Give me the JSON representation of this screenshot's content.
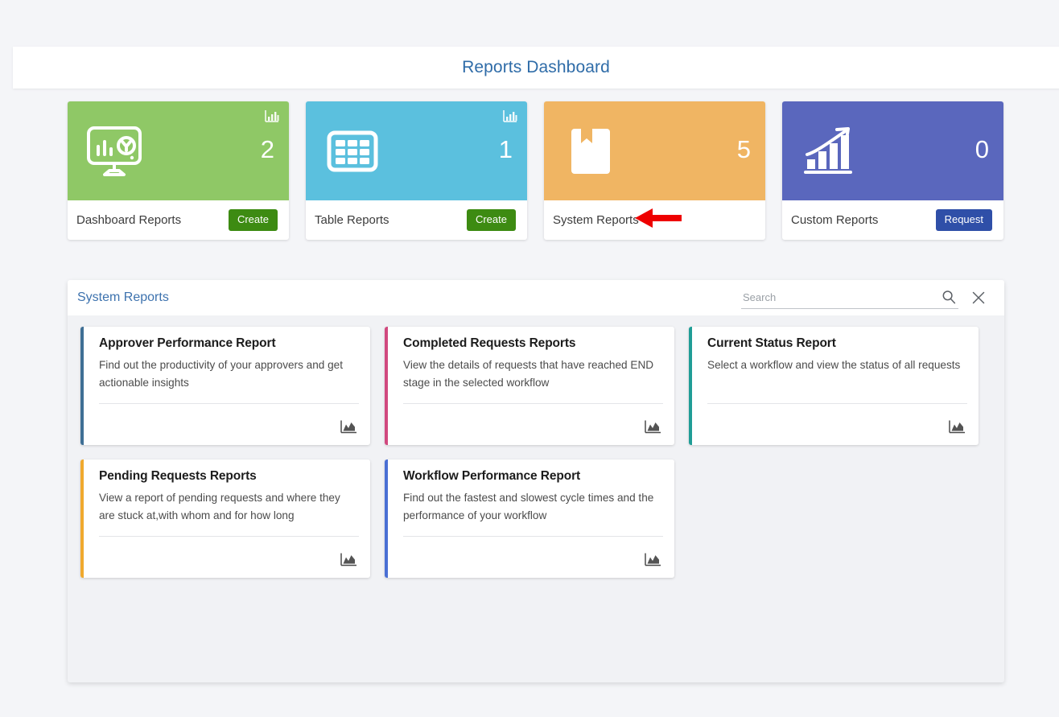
{
  "header": {
    "title": "Reports Dashboard"
  },
  "tiles": [
    {
      "label": "Dashboard Reports",
      "count": "2",
      "color": "#8fc866",
      "icon": "monitor-chart-icon",
      "badge_icon": "bar-chart-badge-icon",
      "has_badge": true,
      "button": {
        "label": "Create",
        "style": "create"
      },
      "annotated": false
    },
    {
      "label": "Table Reports",
      "count": "1",
      "color": "#5bc0de",
      "icon": "table-grid-icon",
      "badge_icon": "bar-chart-badge-icon",
      "has_badge": true,
      "button": {
        "label": "Create",
        "style": "create"
      },
      "annotated": false
    },
    {
      "label": "System Reports",
      "count": "5",
      "color": "#f0b563",
      "icon": "bookmark-book-icon",
      "badge_icon": "",
      "has_badge": false,
      "button": null,
      "annotated": true
    },
    {
      "label": "Custom Reports",
      "count": "0",
      "color": "#5a67bd",
      "icon": "growth-bar-chart-icon",
      "badge_icon": "",
      "has_badge": false,
      "button": {
        "label": "Request",
        "style": "request"
      },
      "annotated": false
    }
  ],
  "panel": {
    "title": "System Reports",
    "search": {
      "value": "",
      "placeholder": "Search",
      "icon": "search-icon",
      "close_icon": "close-icon"
    },
    "cards": [
      {
        "title": "Approver Performance Report",
        "description": "Find out the productivity of your approvers and get actionable insights",
        "accent": "#3f6f95",
        "chart_icon": "area-chart-icon"
      },
      {
        "title": "Completed Requests Reports",
        "description": "View the details of requests that have reached END stage in the selected workflow",
        "accent": "#d1497f",
        "chart_icon": "area-chart-icon"
      },
      {
        "title": "Current Status Report",
        "description": "Select a workflow and view the status of all requests",
        "accent": "#1f9d96",
        "chart_icon": "area-chart-icon"
      },
      {
        "title": "Pending Requests Reports",
        "description": "View a report of pending requests and where they are stuck at,with whom and for how long",
        "accent": "#f0a92e",
        "chart_icon": "area-chart-icon"
      },
      {
        "title": "Workflow Performance Report",
        "description": "Find out the fastest and slowest cycle times and the performance of your workflow",
        "accent": "#4a6fd4",
        "chart_icon": "area-chart-icon"
      }
    ]
  },
  "annotation": {
    "arrow_color": "#ee0000",
    "arrow_direction": "left",
    "points_at": "System Reports"
  }
}
